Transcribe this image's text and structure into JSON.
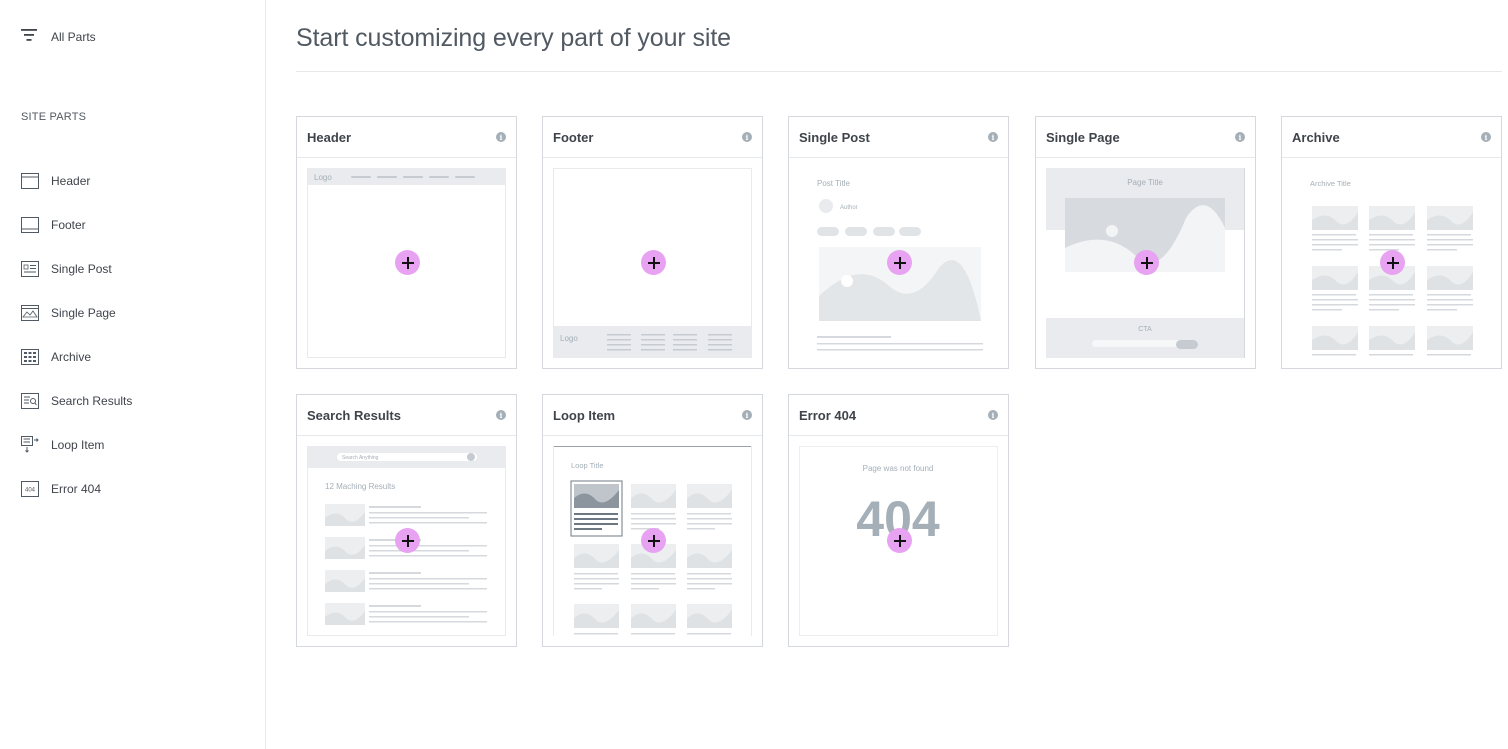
{
  "sidebar": {
    "all_parts_label": "All Parts",
    "section_title": "SITE PARTS",
    "items": [
      {
        "label": "Header",
        "icon": "header-icon"
      },
      {
        "label": "Footer",
        "icon": "footer-icon"
      },
      {
        "label": "Single Post",
        "icon": "single-post-icon"
      },
      {
        "label": "Single Page",
        "icon": "single-page-icon"
      },
      {
        "label": "Archive",
        "icon": "archive-icon"
      },
      {
        "label": "Search Results",
        "icon": "search-results-icon"
      },
      {
        "label": "Loop Item",
        "icon": "loop-item-icon"
      },
      {
        "label": "Error 404",
        "icon": "error-404-icon"
      }
    ]
  },
  "main": {
    "title": "Start customizing every part of your site",
    "cards": [
      {
        "title": "Header",
        "thumb_text": "Logo"
      },
      {
        "title": "Footer",
        "thumb_text": "Logo"
      },
      {
        "title": "Single Post",
        "thumb_text": "Post Title",
        "thumb_sub": "Author"
      },
      {
        "title": "Single Page",
        "thumb_text": "Page Title",
        "thumb_sub": "CTA"
      },
      {
        "title": "Archive",
        "thumb_text": "Archive Title"
      },
      {
        "title": "Search Results",
        "thumb_text": "12 Maching Results",
        "thumb_sub": "Search Anything"
      },
      {
        "title": "Loop Item",
        "thumb_text": "Loop Title"
      },
      {
        "title": "Error 404",
        "thumb_text": "Page was not found",
        "thumb_sub": "404"
      }
    ]
  },
  "colors": {
    "accent_plus": "#e7a3f1",
    "info_icon": "#a4afb7",
    "border": "#d5d8dc"
  }
}
